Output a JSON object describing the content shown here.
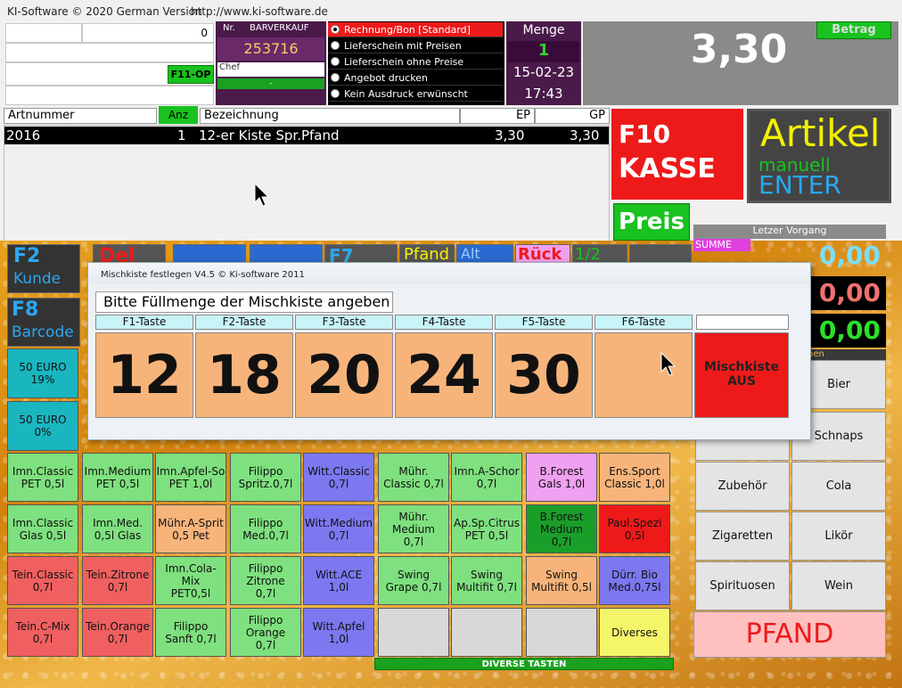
{
  "app": {
    "title": "KI-Software © 2020 German Version",
    "url": "http://www.ki-software.de"
  },
  "left_top": {
    "counter": "0",
    "f11_label": "F11-OP"
  },
  "receipt": {
    "nr_label": "Nr.",
    "type": "BARVERKAUF",
    "number": "253716",
    "user": "Chef",
    "user_bar": "-"
  },
  "print_options": [
    {
      "label": "Rechnung/Bon [Standard]",
      "selected": true
    },
    {
      "label": "Lieferschein mit Preisen",
      "selected": false
    },
    {
      "label": "Lieferschein ohne Preise",
      "selected": false
    },
    {
      "label": "Angebot drucken",
      "selected": false
    },
    {
      "label": "Kein Ausdruck erwünscht",
      "selected": false
    }
  ],
  "menge": {
    "label": "Menge",
    "value": "1",
    "date": "15-02-23",
    "time": "17:43"
  },
  "betrag": {
    "label": "Betrag",
    "value": "3,30"
  },
  "table": {
    "columns": {
      "artnr": "Artnummer",
      "anz": "Anz",
      "bez": "Bezeichnung",
      "ep": "EP",
      "gp": "GP"
    },
    "rows": [
      {
        "artnr": "2016",
        "anz": "1",
        "bez": "12-er Kiste Spr.Pfand",
        "ep": "3,30",
        "gp": "3,30"
      }
    ]
  },
  "buttons": {
    "kasse_l1": "F10",
    "kasse_l2": "KASSE",
    "artikel_l1": "Artikel",
    "artikel_l2": "manuell",
    "artikel_l3": "ENTER",
    "preis": "Preis",
    "pfand": "PFAND"
  },
  "fkeys": [
    {
      "key": "F2",
      "label": "Kunde"
    },
    {
      "key": "Del",
      "label": ""
    },
    {
      "key": "",
      "label": ""
    },
    {
      "key": "",
      "label": ""
    },
    {
      "key": "F7",
      "label": ""
    },
    {
      "key": "Pfand",
      "label": ""
    },
    {
      "key": "Alt",
      "label": ""
    },
    {
      "key": "Rück",
      "label": ""
    },
    {
      "key": "1/2",
      "label": ""
    }
  ],
  "fkey_f8": {
    "key": "F8",
    "label": "Barcode"
  },
  "letzter": {
    "label": "Letzer Vorgang",
    "summe_label": "SUMME",
    "values": [
      "0,00",
      "0,00",
      "0,00"
    ]
  },
  "left_col": [
    {
      "label": "50 EURO\n19%"
    },
    {
      "label": "50 EURO\n0%"
    }
  ],
  "grid": [
    [
      "Imn.Classic\nPET 0,5l",
      "Imn.Medium\nPET 0,5l",
      "Imn.Apfel-So\nPET 1,0l",
      "Filippo\nSpritz.0,7l",
      "Witt.Classic\n0,7l",
      "Mühr.\nClassic 0,7l",
      "Imn.A-Schor\n0,7l",
      "B.Forest\nGals 1,0l",
      "Ens.Sport\nClassic 1,0l"
    ],
    [
      "Imn.Classic\nGlas 0,5l",
      "Imn.Med.\n0,5l Glas",
      "Mühr.A-Sprit\n0,5 Pet",
      "Filippo\nMed.0,7l",
      "Witt.Medium\n0,7l",
      "Mühr.\nMedium\n0,7l",
      "Ap.Sp.Citrus\nPET 0,5l",
      "B.Forest\nMedium\n0,7l",
      "Paul.Spezi\n0,5l"
    ],
    [
      "Tein.Classic\n0,7l",
      "Tein.Zitrone\n0,7l",
      "Imn.Cola-Mix\nPET0,5l",
      "Filippo\nZitrone\n0,7l",
      "Witt.ACE\n1,0l",
      "Swing\nGrape 0,7l",
      "Swing\nMultifit 0,7l",
      "Swing\nMultifit 0,5l",
      "Dürr. Bio\nMed.0,75l"
    ],
    [
      "Tein.C-Mix\n0,7l",
      "Tein.Orange\n0,7l",
      "Filippo\nSanft 0,7l",
      "Filippo\nOrange\n0,7l",
      "Witt.Apfel\n1,0l",
      "",
      "",
      "",
      "Diverses"
    ]
  ],
  "diverse_label": "DIVERSE TASTEN",
  "categories": [
    [
      "",
      "Bier"
    ],
    [
      "",
      "Schnaps"
    ],
    [
      "Zubehör",
      "Cola"
    ],
    [
      "Zigaretten",
      "Likör"
    ],
    [
      "Spirituosen",
      "Wein"
    ]
  ],
  "cat_header": "pen",
  "dialog": {
    "title": "Mischkiste festlegen  V4.5  © Ki-software 2011",
    "prompt": "Bitte Füllmenge der Mischkiste angeben",
    "keys": [
      "F1-Taste",
      "F2-Taste",
      "F3-Taste",
      "F4-Taste",
      "F5-Taste",
      "F6-Taste"
    ],
    "values": [
      "12",
      "18",
      "20",
      "24",
      "30",
      ""
    ],
    "off_l1": "Mischkiste",
    "off_l2": "AUS"
  }
}
